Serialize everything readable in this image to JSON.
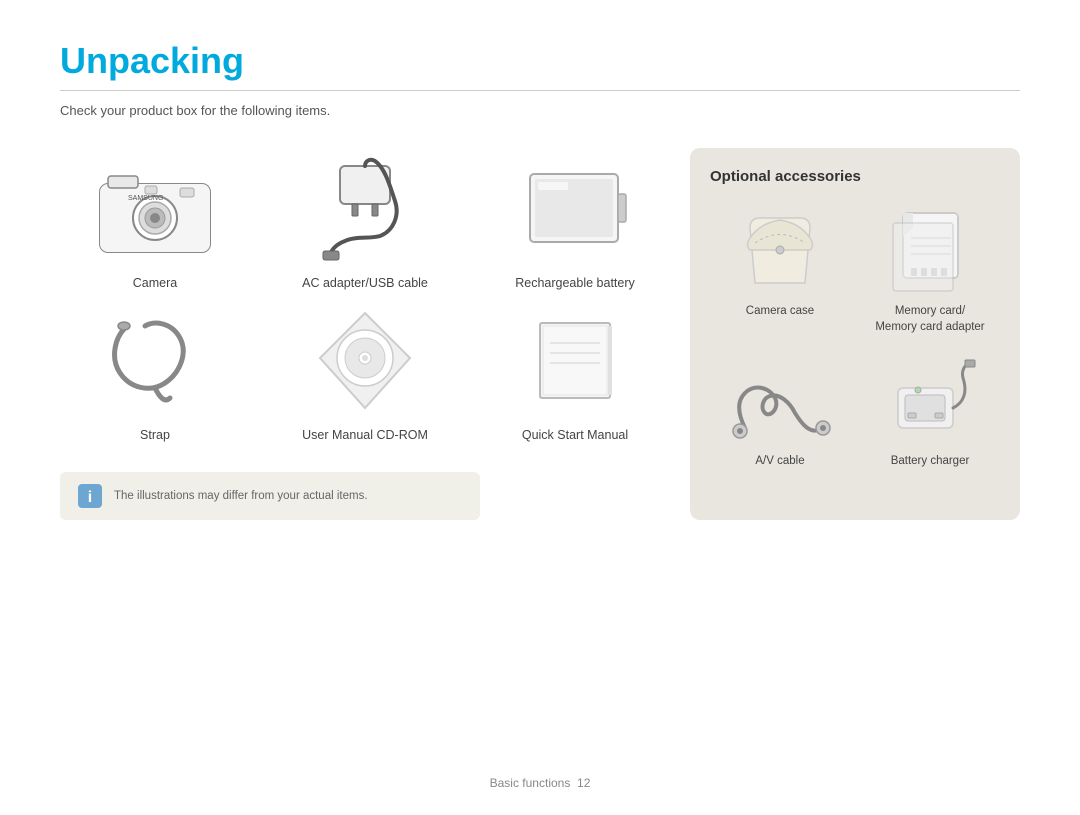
{
  "page": {
    "title": "Unpacking",
    "subtitle": "Check your product box for the following items.",
    "divider": true
  },
  "items": [
    {
      "id": "camera",
      "label": "Camera"
    },
    {
      "id": "ac-adapter",
      "label": "AC adapter/USB cable"
    },
    {
      "id": "rechargeable-battery",
      "label": "Rechargeable battery"
    },
    {
      "id": "strap",
      "label": "Strap"
    },
    {
      "id": "user-manual-cd",
      "label": "User Manual CD-ROM"
    },
    {
      "id": "quick-start",
      "label": "Quick Start Manual"
    }
  ],
  "note": {
    "text": "The illustrations may differ from your actual items."
  },
  "optional": {
    "title": "Optional accessories",
    "items": [
      {
        "id": "camera-case",
        "label": "Camera case"
      },
      {
        "id": "memory-card",
        "label": "Memory card/\nMemory card adapter"
      },
      {
        "id": "av-cable",
        "label": "A/V cable"
      },
      {
        "id": "battery-charger",
        "label": "Battery charger"
      }
    ]
  },
  "footer": {
    "text": "Basic functions",
    "page": "12"
  }
}
